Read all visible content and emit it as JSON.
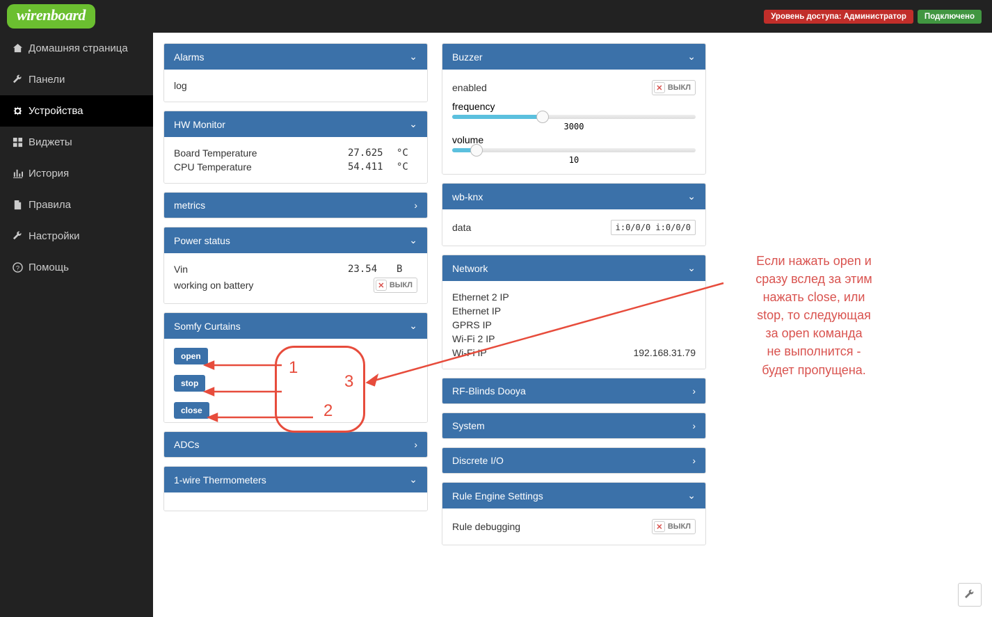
{
  "header": {
    "logo": "wirenboard",
    "access": "Уровень доступа: Администратор",
    "connected": "Подключено"
  },
  "sidebar": {
    "items": [
      {
        "label": "Домашняя страница",
        "icon": "home"
      },
      {
        "label": "Панели",
        "icon": "wrench"
      },
      {
        "label": "Устройства",
        "icon": "gear",
        "active": true
      },
      {
        "label": "Виджеты",
        "icon": "grid"
      },
      {
        "label": "История",
        "icon": "chart"
      },
      {
        "label": "Правила",
        "icon": "file"
      },
      {
        "label": "Настройки",
        "icon": "wrench"
      },
      {
        "label": "Помощь",
        "icon": "help"
      }
    ]
  },
  "alarms": {
    "title": "Alarms",
    "log": "log"
  },
  "hw": {
    "title": "HW Monitor",
    "board_lbl": "Board Temperature",
    "board_v": "27.625",
    "board_u": "°C",
    "cpu_lbl": "CPU Temperature",
    "cpu_v": "54.411",
    "cpu_u": "°C"
  },
  "metrics": {
    "title": "metrics"
  },
  "power": {
    "title": "Power status",
    "vin_lbl": "Vin",
    "vin_v": "23.54",
    "vin_u": "B",
    "bat_lbl": "working on battery",
    "bat_state": "ВЫКЛ"
  },
  "somfy": {
    "title": "Somfy Curtains",
    "open": "open",
    "stop": "stop",
    "close": "close"
  },
  "adc": {
    "title": "ADCs"
  },
  "onewire": {
    "title": "1-wire Thermometers"
  },
  "buzzer": {
    "title": "Buzzer",
    "enabled_lbl": "enabled",
    "enabled_state": "ВЫКЛ",
    "freq_lbl": "frequency",
    "freq_v": "3000",
    "vol_lbl": "volume",
    "vol_v": "10"
  },
  "knx": {
    "title": "wb-knx",
    "data_lbl": "data",
    "data_v": "i:0/0/0 i:0/0/0"
  },
  "net": {
    "title": "Network",
    "eth2": "Ethernet 2 IP",
    "eth": "Ethernet IP",
    "gprs": "GPRS IP",
    "wifi2": "Wi-Fi 2 IP",
    "wifi": "Wi-Fi IP",
    "ip": "192.168.31.79"
  },
  "rfb": {
    "title": "RF-Blinds Dooya"
  },
  "sys": {
    "title": "System"
  },
  "dio": {
    "title": "Discrete I/O"
  },
  "rule": {
    "title": "Rule Engine Settings",
    "dbg_lbl": "Rule debugging",
    "dbg_state": "ВЫКЛ"
  },
  "annotation": {
    "text": "Если нажать open и\nсразу вслед за этим\nнажать close, или\nstop, то следующая\nза open команда\nне выполнится -\nбудет пропущена.",
    "n1": "1",
    "n2": "2",
    "n3": "3"
  }
}
